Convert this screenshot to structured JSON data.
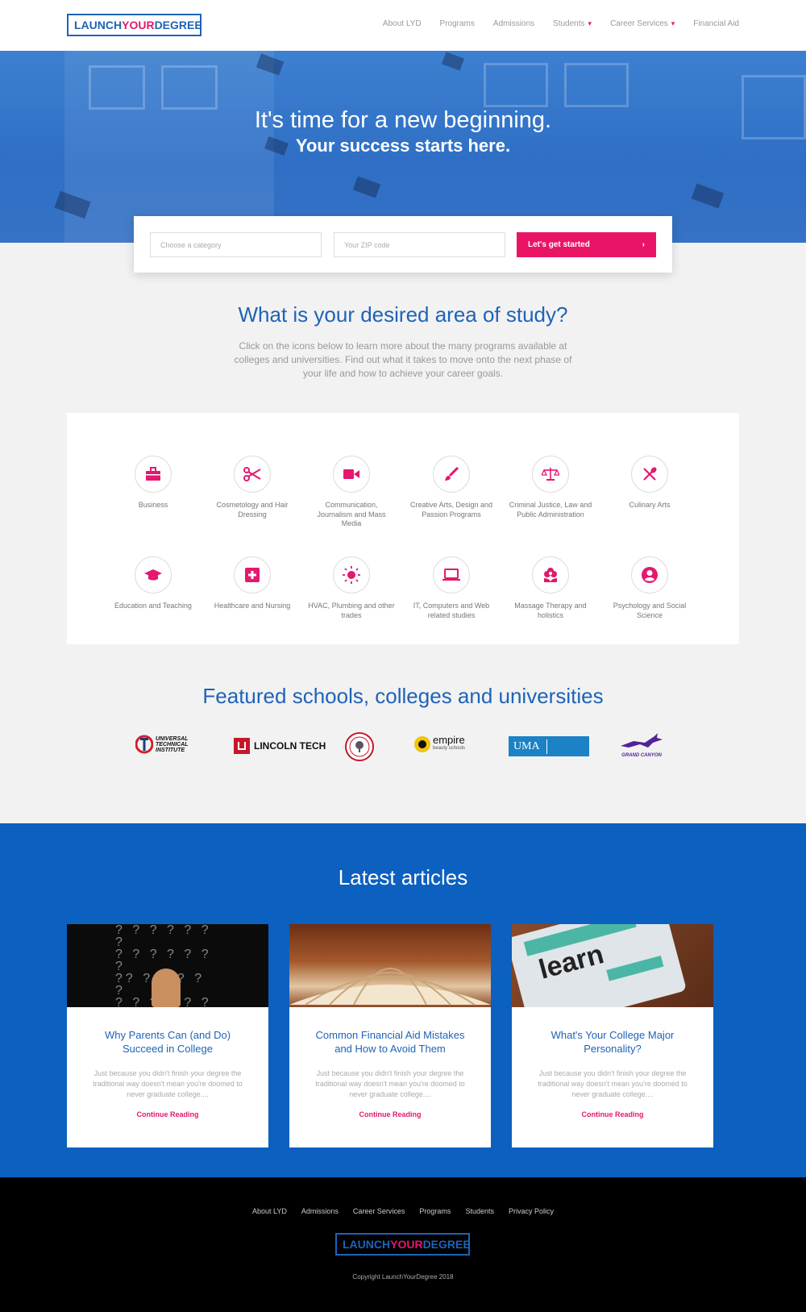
{
  "header": {
    "logo": {
      "part1": "LAUNCH",
      "part2": "YOUR",
      "part3": "DEGREE"
    },
    "nav": [
      {
        "label": "About LYD",
        "dropdown": false
      },
      {
        "label": "Programs",
        "dropdown": false
      },
      {
        "label": "Admissions",
        "dropdown": false
      },
      {
        "label": "Students",
        "dropdown": true
      },
      {
        "label": "Career Services",
        "dropdown": true
      },
      {
        "label": "Financial Aid",
        "dropdown": false
      }
    ]
  },
  "hero": {
    "line1": "It's time for a new beginning.",
    "line2": "Your success starts here."
  },
  "search": {
    "category_placeholder": "Choose a category",
    "zip_placeholder": "Your ZIP code",
    "button_label": "Let's get started",
    "button_icon": "chevron-right-icon"
  },
  "study": {
    "title": "What is your desired area of study?",
    "description": "Click on the icons below to learn more about the many programs available at colleges and universities. Find out what it takes to move onto the next phase of your life and how to achieve your career goals.",
    "categories": [
      {
        "label": "Business",
        "icon": "briefcase-icon"
      },
      {
        "label": "Cosmetology and Hair Dressing",
        "icon": "scissors-icon"
      },
      {
        "label": "Communication, Journalism and Mass Media",
        "icon": "video-camera-icon"
      },
      {
        "label": "Creative Arts, Design and Passion Programs",
        "icon": "paintbrush-icon"
      },
      {
        "label": "Criminal Justice, Law and Public Administration",
        "icon": "scales-icon"
      },
      {
        "label": "Culinary Arts",
        "icon": "fork-knife-icon"
      },
      {
        "label": "Education and Teaching",
        "icon": "graduation-cap-icon"
      },
      {
        "label": "Healthcare and Nursing",
        "icon": "medical-cross-icon"
      },
      {
        "label": "HVAC, Plumbing and other trades",
        "icon": "sun-icon"
      },
      {
        "label": "IT, Computers and Web related studies",
        "icon": "laptop-icon"
      },
      {
        "label": "Massage Therapy and holistics",
        "icon": "flower-icon"
      },
      {
        "label": "Psychology and Social Science",
        "icon": "person-circle-icon"
      }
    ]
  },
  "featured": {
    "title": "Featured schools, colleges and universities",
    "schools": [
      {
        "name": "Universal Technical Institute",
        "line1": "UNIVERSAL",
        "line2": "TECHNICAL",
        "line3": "INSTITUTE"
      },
      {
        "name": "Lincoln Tech",
        "label": "LINCOLN TECH"
      },
      {
        "name": "Seal logo"
      },
      {
        "name": "Empire Beauty Schools",
        "label": "empire",
        "sub": "beauty schools"
      },
      {
        "name": "Ultimate Medical Academy",
        "label": "UMA"
      },
      {
        "name": "Grand Canyon University",
        "label": "GRAND CANYON"
      }
    ]
  },
  "articles": {
    "title": "Latest articles",
    "items": [
      {
        "title": "Why Parents Can (and Do) Succeed in College",
        "excerpt": "Just because you didn't finish your degree the traditional way doesn't mean you're doomed to never graduate college....",
        "link": "Continue Reading"
      },
      {
        "title": "Common Financial Aid Mistakes and How to Avoid Them",
        "excerpt": "Just because you didn't finish your degree the traditional way doesn't mean you're doomed to never graduate college....",
        "link": "Continue Reading"
      },
      {
        "title": "What's Your College Major Personality?",
        "excerpt": "Just because you didn't finish your degree the traditional way doesn't mean you're doomed to never graduate college....",
        "link": "Continue Reading"
      }
    ]
  },
  "footer": {
    "nav": [
      "About LYD",
      "Admissions",
      "Career Services",
      "Programs",
      "Students",
      "Privacy Policy"
    ],
    "copyright": "Copyright LaunchYourDegree 2018"
  },
  "colors": {
    "brand_blue": "#1e63b8",
    "accent_pink": "#e3186e",
    "articles_bg": "#0c60bf"
  }
}
